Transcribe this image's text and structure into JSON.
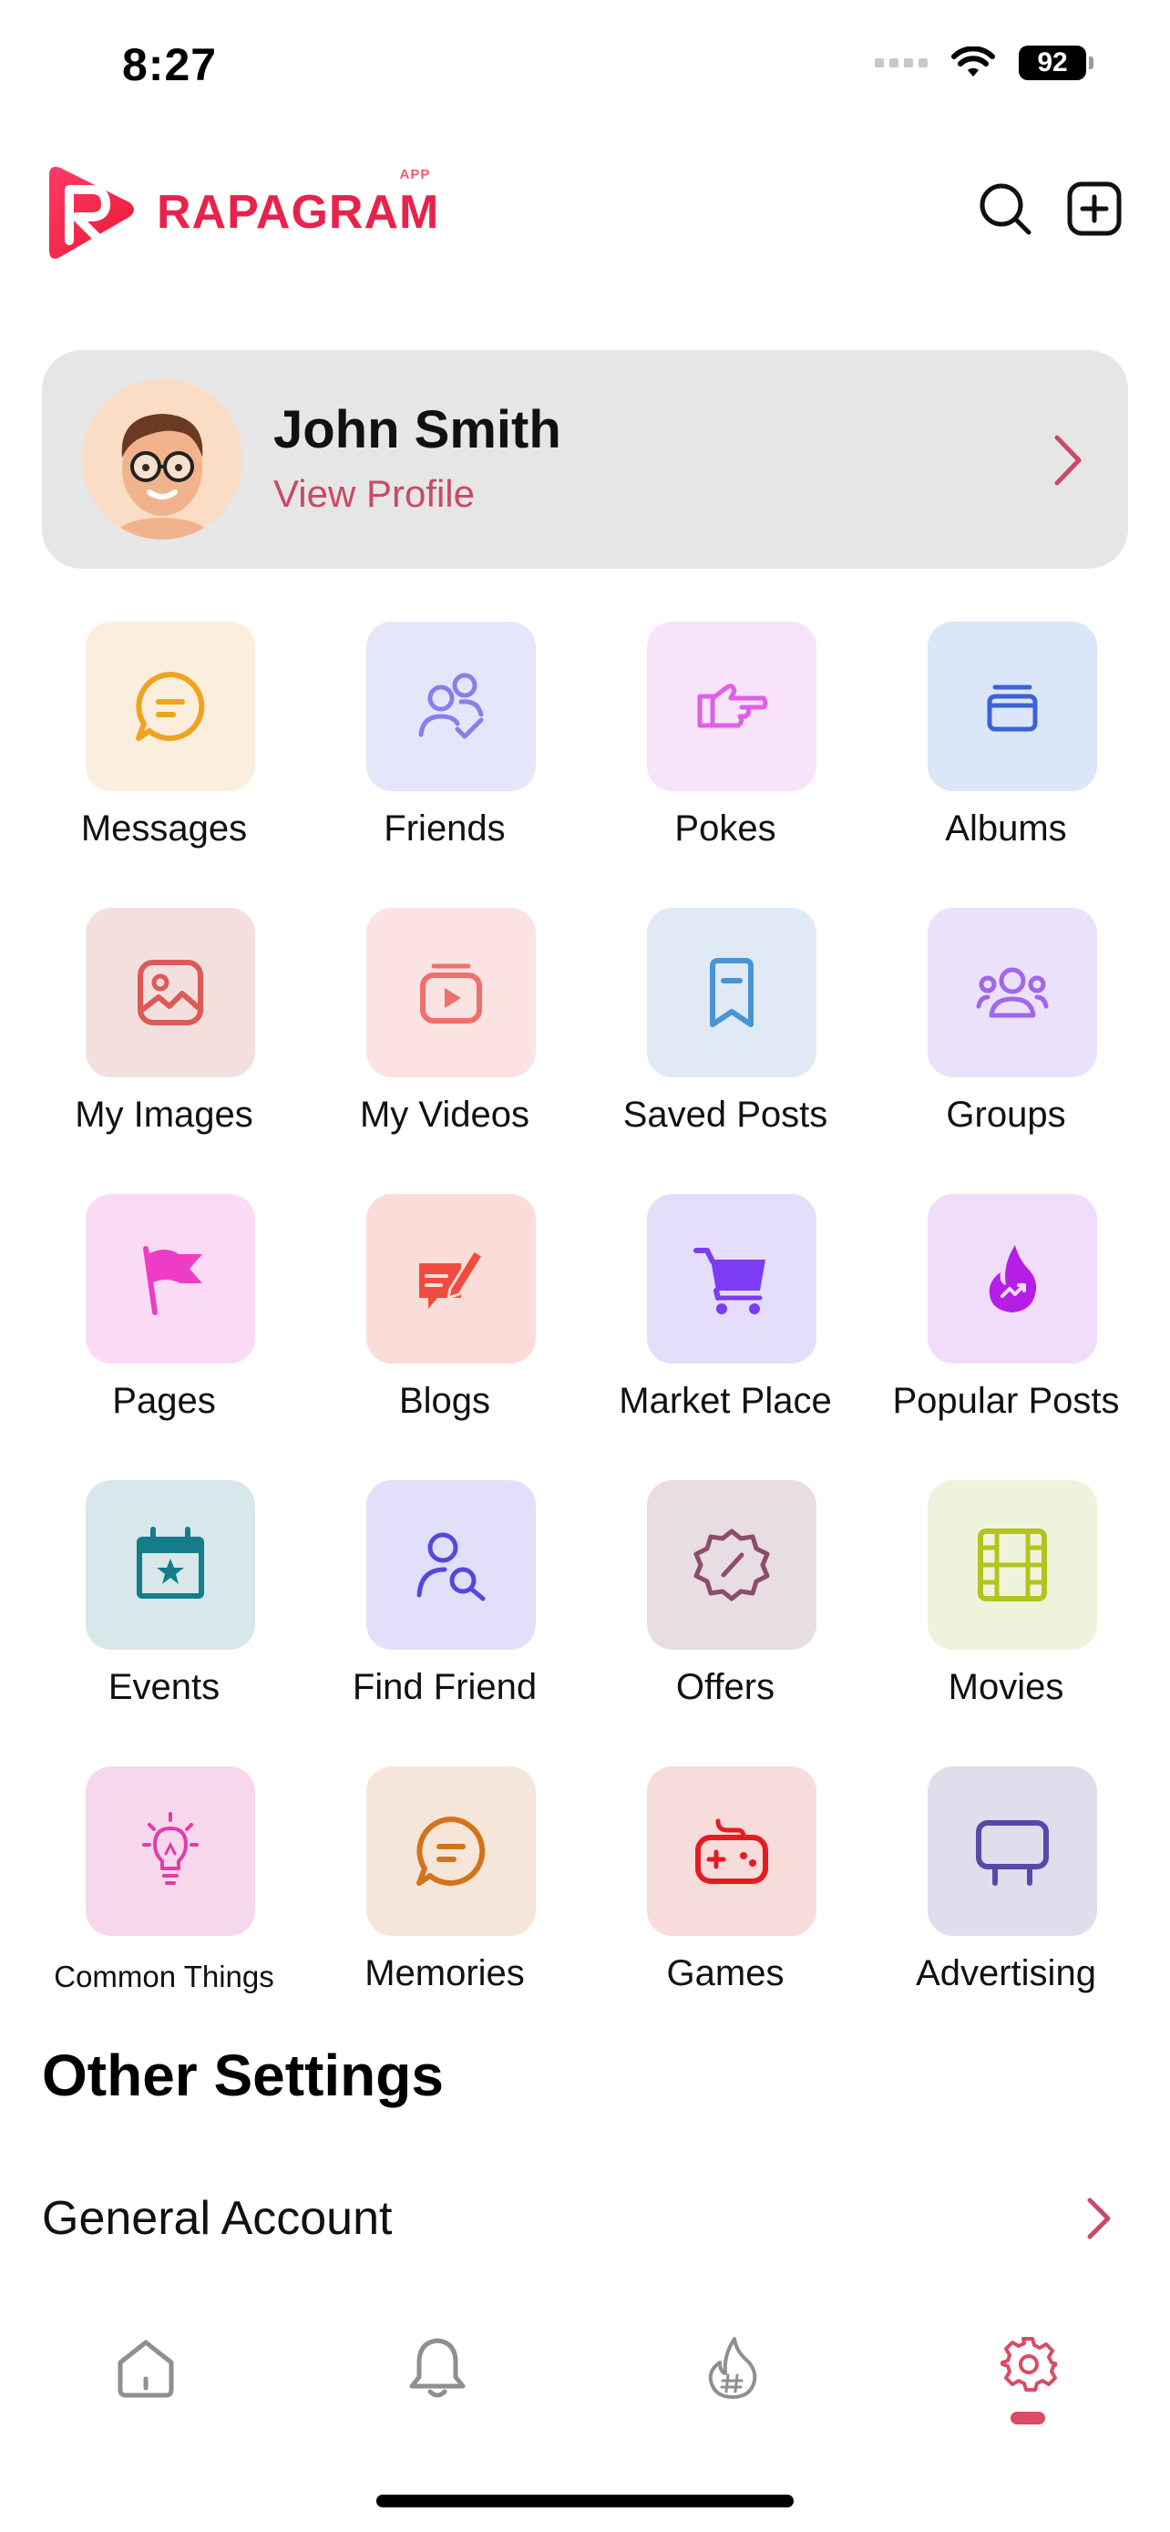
{
  "status_bar": {
    "time": "8:27",
    "battery": "92"
  },
  "header": {
    "logo_text": "RAPAGRAM",
    "logo_sup": "APP"
  },
  "profile": {
    "name": "John Smith",
    "link_label": "View Profile"
  },
  "menu": [
    {
      "label": "Messages",
      "icon": "chat-icon",
      "bg": "#fbeedd",
      "color": "#f0a31e"
    },
    {
      "label": "Friends",
      "icon": "friends-icon",
      "bg": "#e6e6fb",
      "color": "#8b7fe6"
    },
    {
      "label": "Pokes",
      "icon": "poke-hand-icon",
      "bg": "#f8e3fa",
      "color": "#e05fe6"
    },
    {
      "label": "Albums",
      "icon": "album-icon",
      "bg": "#dbe6f8",
      "color": "#3c63d6"
    },
    {
      "label": "My Images",
      "icon": "image-icon",
      "bg": "#f3e0de",
      "color": "#dc5a58"
    },
    {
      "label": "My Videos",
      "icon": "video-icon",
      "bg": "#fae3e2",
      "color": "#ef6f6b"
    },
    {
      "label": "Saved Posts",
      "icon": "bookmark-icon",
      "bg": "#dfeaf6",
      "color": "#4a93d4"
    },
    {
      "label": "Groups",
      "icon": "groups-icon",
      "bg": "#ebe1fa",
      "color": "#a068e8"
    },
    {
      "label": "Pages",
      "icon": "flag-icon",
      "bg": "#fbdaf5",
      "color": "#ee3cc6"
    },
    {
      "label": "Blogs",
      "icon": "blog-edit-icon",
      "bg": "#fbdcd8",
      "color": "#ef4b3e"
    },
    {
      "label": "Market Place",
      "icon": "cart-icon",
      "bg": "#e4ddfb",
      "color": "#7b3cf3"
    },
    {
      "label": "Popular Posts",
      "icon": "fire-icon",
      "bg": "#f1dcfa",
      "color": "#b61ee6"
    },
    {
      "label": "Events",
      "icon": "calendar-star-icon",
      "bg": "#d7e7ea",
      "color": "#157c8a"
    },
    {
      "label": "Find Friend",
      "icon": "find-user-icon",
      "bg": "#e2dffb",
      "color": "#5647dc"
    },
    {
      "label": "Offers",
      "icon": "discount-badge-icon",
      "bg": "#e7dde2",
      "color": "#8a4e66"
    },
    {
      "label": "Movies",
      "icon": "film-icon",
      "bg": "#eef4dc",
      "color": "#b3c41c"
    },
    {
      "label": "Common Things",
      "icon": "lightbulb-icon",
      "bg": "#f7d7ec",
      "color": "#e23ca6"
    },
    {
      "label": "Memories",
      "icon": "memory-chat-icon",
      "bg": "#f6e6d9",
      "color": "#d3731c"
    },
    {
      "label": "Games",
      "icon": "gamepad-icon",
      "bg": "#f8dcda",
      "color": "#e41c22"
    },
    {
      "label": "Advertising",
      "icon": "billboard-icon",
      "bg": "#e0dded",
      "color": "#5a47a8"
    }
  ],
  "other_settings": {
    "title": "Other Settings",
    "rows": [
      {
        "label": "General Account"
      }
    ]
  },
  "tab_bar": {
    "tabs": [
      {
        "name": "home-icon"
      },
      {
        "name": "bell-icon"
      },
      {
        "name": "trending-hashtag-icon"
      },
      {
        "name": "settings-gear-icon",
        "active": true
      }
    ],
    "active_color": "#d94c64"
  }
}
